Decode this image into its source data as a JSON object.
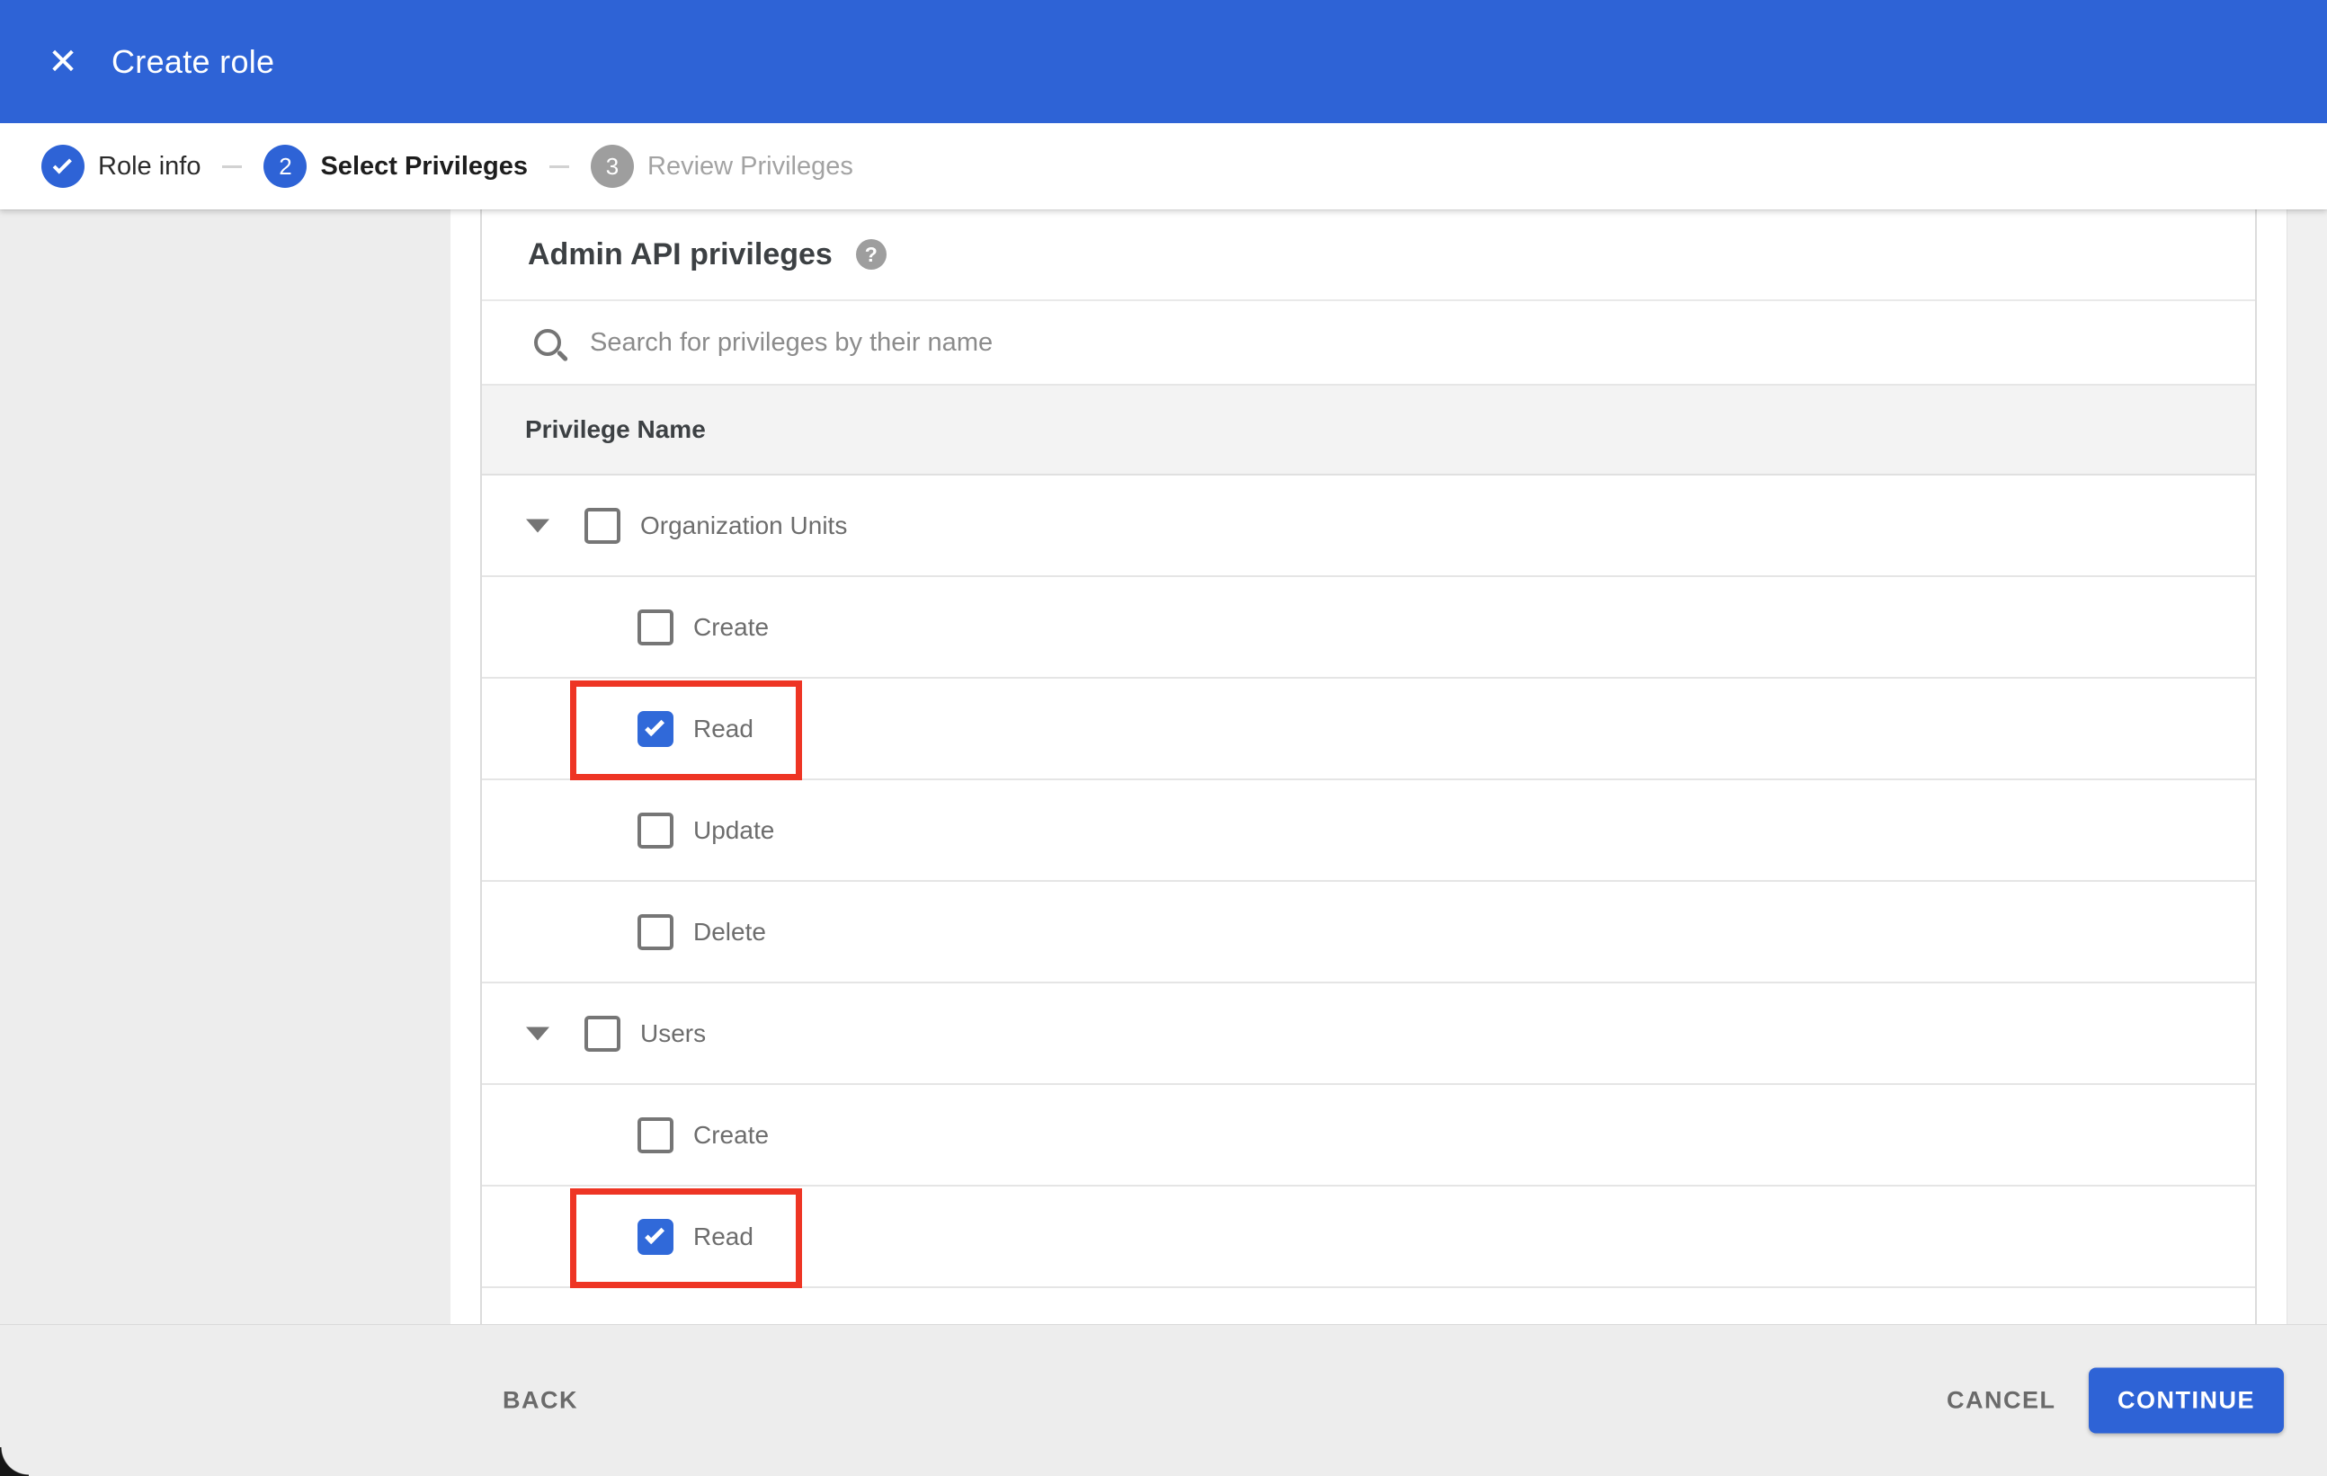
{
  "colors": {
    "primary_blue": "#2e63d6",
    "checkbox_blue": "#3069d9",
    "highlight_red": "#ee3524",
    "page_gray": "#ededed"
  },
  "header": {
    "title": "Create role",
    "close_glyph": "✕"
  },
  "stepper": {
    "steps": [
      {
        "label": "Role info",
        "state": "done"
      },
      {
        "number": "2",
        "label": "Select Privileges",
        "state": "active"
      },
      {
        "number": "3",
        "label": "Review Privileges",
        "state": "upcoming"
      }
    ]
  },
  "panel": {
    "heading": "Admin API privileges",
    "help_glyph": "?",
    "search_placeholder": "Search for privileges by their name",
    "table": {
      "header": "Privilege Name",
      "rows": [
        {
          "label": "Organization Units",
          "type": "parent",
          "checked": false,
          "highlighted": false
        },
        {
          "label": "Create",
          "type": "child",
          "checked": false,
          "highlighted": false
        },
        {
          "label": "Read",
          "type": "child",
          "checked": true,
          "highlighted": true
        },
        {
          "label": "Update",
          "type": "child",
          "checked": false,
          "highlighted": false
        },
        {
          "label": "Delete",
          "type": "child",
          "checked": false,
          "highlighted": false
        },
        {
          "label": "Users",
          "type": "parent",
          "checked": false,
          "highlighted": false
        },
        {
          "label": "Create",
          "type": "child",
          "checked": false,
          "highlighted": false
        },
        {
          "label": "Read",
          "type": "child",
          "checked": true,
          "highlighted": true
        }
      ]
    }
  },
  "footer": {
    "back_label": "BACK",
    "cancel_label": "CANCEL",
    "continue_label": "CONTINUE"
  }
}
